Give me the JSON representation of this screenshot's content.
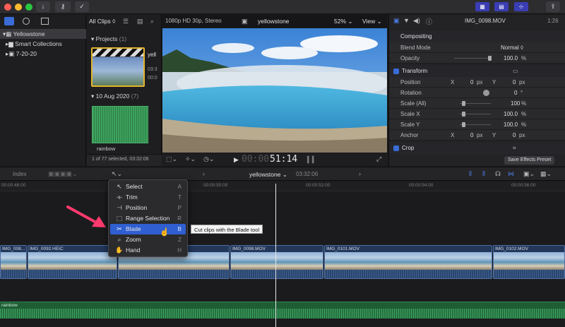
{
  "titlebar": {
    "lights": {
      "close": "#ff5f57",
      "minimize": "#febc2e",
      "zoom": "#28c840"
    },
    "buttons": [
      "↓",
      "⚷",
      "✓"
    ],
    "right_icons": [
      "▦",
      "▤",
      "⊹",
      "⇪"
    ]
  },
  "library": {
    "items": [
      {
        "label": "Yellowstone",
        "selected": true
      },
      {
        "label": "Smart Collections",
        "selected": false
      },
      {
        "label": "7-20-20",
        "selected": false
      }
    ]
  },
  "browser": {
    "filter_label": "All Clips",
    "projects_header": "Projects",
    "projects_count": "(1)",
    "project_name": "yell",
    "project_meta_1": "03:3",
    "project_meta_2": "00:0",
    "date_header": "10 Aug 2020",
    "date_count": "(7)",
    "clip_name": "rainbow",
    "status": "1 of 77 selected, 03:32:06"
  },
  "viewer": {
    "format": "1080p HD 30p, Stereo",
    "title": "yellowstone",
    "zoom": "52%",
    "view_label": "View",
    "timecode_dim": "00:00",
    "timecode": "51:14"
  },
  "inspector": {
    "clip_name": "IMG_0098.MOV",
    "duration": "1:26",
    "compositing_label": "Compositing",
    "blend_mode_label": "Blend Mode",
    "blend_mode_value": "Normal ◊",
    "opacity_label": "Opacity",
    "opacity_value": "100.0",
    "opacity_unit": "%",
    "transform_label": "Transform",
    "position_label": "Position",
    "position_x_label": "X",
    "position_x": "0",
    "position_x_unit": "px",
    "position_y_label": "Y",
    "position_y": "0",
    "position_y_unit": "px",
    "rotation_label": "Rotation",
    "rotation_value": "0",
    "rotation_unit": "°",
    "scale_all_label": "Scale (All)",
    "scale_all_value": "100",
    "scale_all_unit": "%",
    "scale_x_label": "Scale X",
    "scale_x_value": "100.0",
    "scale_x_unit": "%",
    "scale_y_label": "Scale Y",
    "scale_y_value": "100.0",
    "scale_y_unit": "%",
    "anchor_label": "Anchor",
    "anchor_x_label": "X",
    "anchor_x": "0",
    "anchor_x_unit": "px",
    "anchor_y_label": "Y",
    "anchor_y": "0",
    "anchor_y_unit": "px",
    "crop_label": "Crop",
    "save_preset_label": "Save Effects Preset"
  },
  "timeline_bar": {
    "index_label": "Index",
    "project_title": "yellowstone",
    "duration": "03:32:06"
  },
  "ruler": {
    "ticks": [
      "00:00:48:00",
      "00:00:50:00",
      "00:00:52:00",
      "00:00:54:00",
      "00:00:56:00"
    ]
  },
  "clips": [
    {
      "name": "IMG_008..."
    },
    {
      "name": "IMG_0092.HEIC"
    },
    {
      "name": ""
    },
    {
      "name": "IMG_0098.MOV"
    },
    {
      "name": "IMG_0101.MOV"
    },
    {
      "name": "IMG_0102.MOV"
    }
  ],
  "audio_clip": {
    "name": "rainbow"
  },
  "tool_menu": {
    "items": [
      {
        "icon": "arrow-icon",
        "label": "Select",
        "key": "A",
        "active": false
      },
      {
        "icon": "trim-icon",
        "label": "Trim",
        "key": "T",
        "active": false
      },
      {
        "icon": "position-icon",
        "label": "Position",
        "key": "P",
        "active": false
      },
      {
        "icon": "range-icon",
        "label": "Range Selection",
        "key": "R",
        "active": false
      },
      {
        "icon": "blade-icon",
        "label": "Blade",
        "key": "B",
        "active": true
      },
      {
        "icon": "zoom-icon",
        "label": "Zoom",
        "key": "Z",
        "active": false
      },
      {
        "icon": "hand-icon",
        "label": "Hand",
        "key": "H",
        "active": false
      }
    ]
  },
  "tooltip": "Cut clips with the Blade tool",
  "colors": {
    "accent": "#2f5fd0",
    "arrow": "#ff3a6e",
    "audio": "#1f5d35"
  }
}
